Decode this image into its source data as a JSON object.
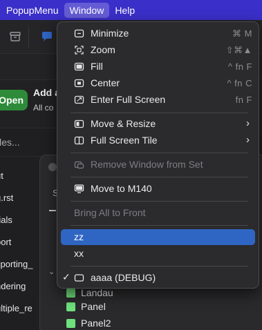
{
  "menubar": {
    "items": [
      "PopupMenu",
      "Window",
      "Help"
    ],
    "active": "Window",
    "bg": "#3a2fc9"
  },
  "app": {
    "open_button": "Open",
    "panel_title": "Add a",
    "panel_subtitle": "All co",
    "filter_placeholder": "iles...",
    "files": [
      "ut",
      "g.rst",
      "rials",
      "port",
      "xporting_",
      "ndering",
      "ultiple_re"
    ],
    "subwindow_label": "S",
    "list": [
      "Panel",
      "Panel2"
    ],
    "list_partial": "Landau",
    "swatch_color": "#6fe07c"
  },
  "menu": {
    "items": [
      {
        "label": "Minimize",
        "icon": "minimize-window-icon",
        "shortcut": "⌘ M"
      },
      {
        "label": "Zoom",
        "icon": "zoom-icon",
        "shortcut": "⇧⌘▲"
      },
      {
        "label": "Fill",
        "icon": "fill-icon",
        "shortcut": "^ fn F"
      },
      {
        "label": "Center",
        "icon": "center-icon",
        "shortcut": "^ fn C"
      },
      {
        "label": "Enter Full Screen",
        "icon": "enter-full-screen-icon",
        "shortcut": "fn F"
      },
      {
        "label": "Move & Resize",
        "icon": "move-resize-icon",
        "submenu": true
      },
      {
        "label": "Full Screen Tile",
        "icon": "full-screen-tile-icon",
        "submenu": true
      },
      {
        "label": "Remove Window from Set",
        "icon": "remove-window-icon",
        "disabled": true
      },
      {
        "label": "Move to M140",
        "icon": "display-icon"
      },
      {
        "label": "Bring All to Front",
        "disabled": true
      },
      {
        "label": "zz",
        "highlighted": true
      },
      {
        "label": "xx"
      },
      {
        "label": "aaaa (DEBUG)",
        "icon": "window-icon",
        "checked": true
      }
    ],
    "highlight_color": "#2f66c4"
  }
}
